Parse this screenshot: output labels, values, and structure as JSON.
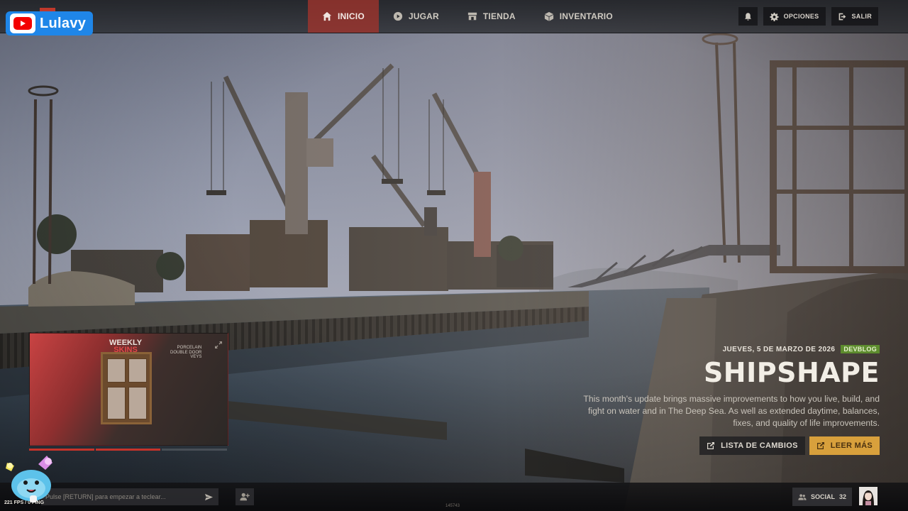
{
  "overlay": {
    "channel_name": "Lulavy"
  },
  "nav": {
    "items": [
      {
        "label": "INICIO",
        "icon": "home-icon",
        "active": true
      },
      {
        "label": "JUGAR",
        "icon": "play-circle-icon",
        "active": false
      },
      {
        "label": "TIENDA",
        "icon": "store-icon",
        "active": false
      },
      {
        "label": "INVENTARIO",
        "icon": "cube-icon",
        "active": false
      }
    ]
  },
  "toolbar": {
    "notifications_icon": "bell-icon",
    "options_label": "OPCIONES",
    "options_icon": "gear-icon",
    "exit_label": "SALIR",
    "exit_icon": "exit-icon"
  },
  "news": {
    "date": "JUEVES, 5 DE MARZO DE 2026",
    "tag": "DEVBLOG",
    "title": "SHIPSHAPE",
    "body": "This month's update brings massive improvements to how you live, build, and fight on water and in The Deep Sea. As well as extended daytime, balances, fixes, and quality of life improvements.",
    "changelog_label": "LISTA DE CAMBIOS",
    "read_more_label": "LEER MÁS"
  },
  "promo": {
    "title_line1": "WEEKLY",
    "title_line2": "SKINS",
    "items": [
      "PORCELAIN",
      "DOUBLE DOOR",
      "VEYS"
    ],
    "progress": [
      1.0,
      1.0,
      0.0
    ]
  },
  "chat": {
    "placeholder": "Pulse [RETURN] para empezar a teclear..."
  },
  "status": {
    "fps": "221 FPS / 0 PING",
    "build": "145743"
  },
  "social": {
    "label": "SOCIAL",
    "count": "32"
  },
  "colors": {
    "accent_red": "#a6342c",
    "gold": "#d8a03c",
    "tag_green": "#5d8c2e",
    "brand_blue": "#1f86e8"
  }
}
